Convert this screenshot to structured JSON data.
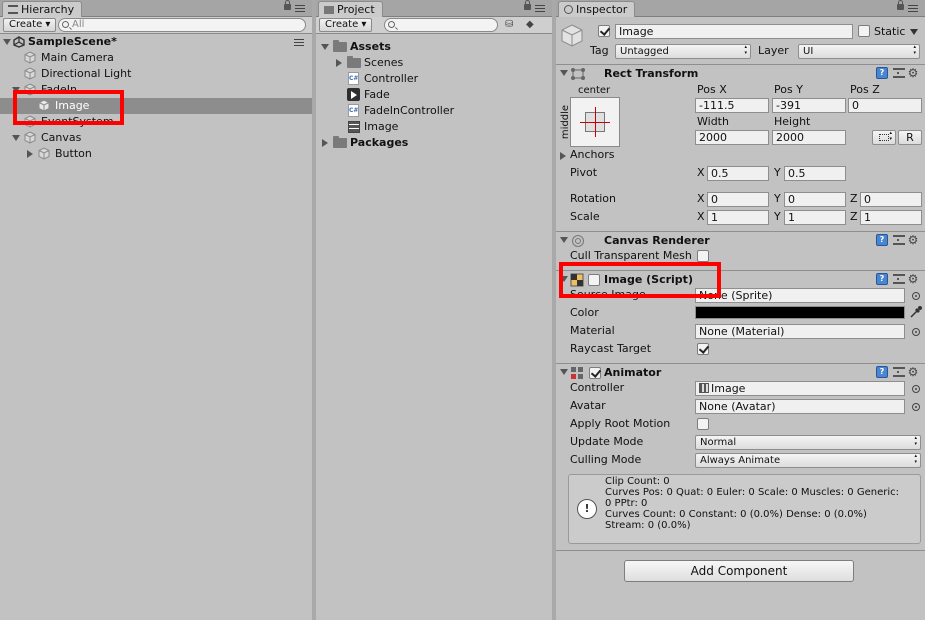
{
  "hierarchy": {
    "tab_label": "Hierarchy",
    "create_label": "Create",
    "search_placeholder": "All",
    "scene_name": "SampleScene*",
    "items": [
      "Main Camera",
      "Directional Light",
      "FadeIn",
      "Image",
      "EventSystem",
      "Canvas",
      "Button"
    ]
  },
  "project": {
    "tab_label": "Project",
    "create_label": "Create",
    "search_value": "",
    "assets_label": "Assets",
    "assets_items": [
      "Scenes",
      "Controller",
      "Fade",
      "FadeInController",
      "Image"
    ],
    "packages_label": "Packages"
  },
  "inspector": {
    "tab_label": "Inspector",
    "object_name": "Image",
    "static_label": "Static",
    "static_checked": false,
    "active_checked": true,
    "tag_label": "Tag",
    "tag_value": "Untagged",
    "layer_label": "Layer",
    "layer_value": "UI",
    "rect_transform": {
      "title": "Rect Transform",
      "anchor_h": "center",
      "anchor_v": "middle",
      "pos_x_label": "Pos X",
      "pos_y_label": "Pos Y",
      "pos_z_label": "Pos Z",
      "pos_x": "-111.5",
      "pos_y": "-391",
      "pos_z": "0",
      "width_label": "Width",
      "height_label": "Height",
      "width": "2000",
      "height": "2000",
      "raw_label": "R",
      "anchors_label": "Anchors",
      "pivot_label": "Pivot",
      "pivot_x": "0.5",
      "pivot_y": "0.5",
      "rotation_label": "Rotation",
      "rot_x": "0",
      "rot_y": "0",
      "rot_z": "0",
      "scale_label": "Scale",
      "scale_x": "1",
      "scale_y": "1",
      "scale_z": "1",
      "x": "X",
      "y": "Y",
      "z": "Z"
    },
    "canvas_renderer": {
      "title": "Canvas Renderer",
      "cull_label": "Cull Transparent Mesh"
    },
    "image_script": {
      "title": "Image (Script)",
      "source_label": "Source Image",
      "source_value": "None (Sprite)",
      "color_label": "Color",
      "color_value": "#000000",
      "material_label": "Material",
      "material_value": "None (Material)",
      "raycast_label": "Raycast Target",
      "raycast_checked": true
    },
    "animator": {
      "title": "Animator",
      "controller_label": "Controller",
      "controller_value": "Image",
      "avatar_label": "Avatar",
      "avatar_value": "None (Avatar)",
      "root_motion_label": "Apply Root Motion",
      "update_label": "Update Mode",
      "update_value": "Normal",
      "culling_label": "Culling Mode",
      "culling_value": "Always Animate",
      "info_lines": [
        "Clip Count: 0",
        "Curves Pos: 0 Quat: 0 Euler: 0 Scale: 0 Muscles: 0 Generic:",
        "0 PPtr: 0",
        "Curves Count: 0 Constant: 0 (0.0%) Dense: 0 (0.0%)",
        "Stream: 0 (0.0%)"
      ]
    },
    "add_component_label": "Add Component"
  },
  "colors": {
    "highlight": "#ff0000",
    "selection": "#8d8d8d",
    "panel": "#c2c2c2"
  }
}
